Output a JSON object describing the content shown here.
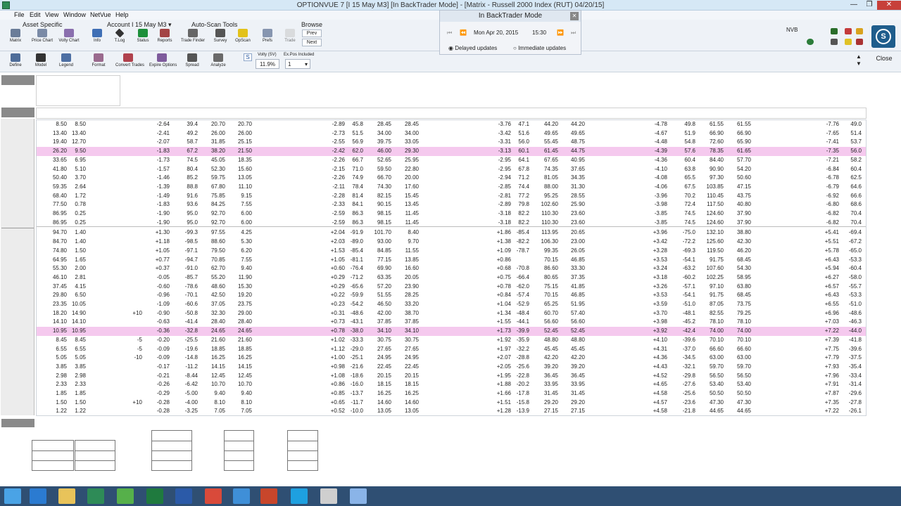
{
  "window": {
    "title": "OPTIONVUE 7   [I 15 May M3]   [In BackTrader Mode]  -  [Matrix - Russell 2000 Index (RUT)  04/20/15]",
    "minimize": "—",
    "restore": "❐",
    "close": "✕"
  },
  "menu": [
    "File",
    "Edit",
    "View",
    "Window",
    "NetVue",
    "Help"
  ],
  "toolbar": {
    "group_asset": "Asset Specific",
    "group_account": "Account I 15 May M3 ▾",
    "group_autoscan": "Auto-Scan Tools",
    "group_browse": "Browse",
    "buttons": [
      {
        "label": "Matrix",
        "icon": "matrix-icon"
      },
      {
        "label": "Price Chart",
        "icon": "price-chart-icon"
      },
      {
        "label": "Volty Chart",
        "icon": "volty-chart-icon"
      },
      {
        "label": "Info",
        "icon": "info-icon"
      },
      {
        "label": "T.Log",
        "icon": "tlog-icon"
      },
      {
        "label": "Status",
        "icon": "status-icon"
      },
      {
        "label": "Reports",
        "icon": "reports-icon"
      },
      {
        "label": "Trade Finder",
        "icon": "trade-finder-icon"
      },
      {
        "label": "Survey",
        "icon": "survey-icon"
      },
      {
        "label": "OpScan",
        "icon": "opscan-icon"
      },
      {
        "label": "Prefs",
        "icon": "prefs-icon"
      },
      {
        "label": "Trade",
        "icon": "trade-icon"
      }
    ],
    "browse_prev": "Prev",
    "browse_next": "Next"
  },
  "toolbar2": {
    "buttons": [
      {
        "label": "Define",
        "icon": "define-icon"
      },
      {
        "label": "Model",
        "icon": "model-icon"
      },
      {
        "label": "Legend",
        "icon": "legend-icon"
      },
      {
        "label": "Format",
        "icon": "format-icon"
      },
      {
        "label": "Convert Trades",
        "icon": "convert-trades-icon"
      },
      {
        "label": "Expire Options",
        "icon": "expire-options-icon"
      },
      {
        "label": "Spread",
        "icon": "spread-icon"
      },
      {
        "label": "Analyze",
        "icon": "analyze-icon"
      }
    ],
    "s_button": "S",
    "volty_label": "Volty (SV)",
    "volty_value": "11.9%",
    "expos_label": "Ex.Pos Included",
    "expos_value": "1"
  },
  "backtrader": {
    "title": "In BackTrader Mode",
    "date": "Mon Apr 20, 2015",
    "time": "15:30",
    "delayed": "Delayed updates",
    "immediate": "Immediate updates"
  },
  "right": {
    "nvb": "NVB",
    "close": "Close"
  },
  "rows": [
    {
      "c": [
        "8.50",
        "8.50",
        "",
        "-2.64",
        "39.4",
        "20.70",
        "20.70",
        "-2.89",
        "45.8",
        "28.45",
        "28.45",
        "-3.76",
        "47.1",
        "44.20",
        "44.20",
        "-4.78",
        "49.8",
        "61.55",
        "61.55",
        "-7.76",
        "49.0"
      ]
    },
    {
      "c": [
        "13.40",
        "13.40",
        "",
        "-2.41",
        "49.2",
        "26.00",
        "26.00",
        "-2.73",
        "51.5",
        "34.00",
        "34.00",
        "-3.42",
        "51.6",
        "49.65",
        "49.65",
        "-4.67",
        "51.9",
        "66.90",
        "66.90",
        "-7.65",
        "51.4"
      ]
    },
    {
      "c": [
        "19.40",
        "12.70",
        "",
        "-2.07",
        "58.7",
        "31.85",
        "25.15",
        "-2.55",
        "56.9",
        "39.75",
        "33.05",
        "-3.31",
        "56.0",
        "55.45",
        "48.75",
        "-4.48",
        "54.8",
        "72.60",
        "65.90",
        "-7.41",
        "53.7"
      ]
    },
    {
      "c": [
        "26.20",
        "9.50",
        "",
        "-1.83",
        "67.2",
        "38.20",
        "21.50",
        "-2.42",
        "62.0",
        "46.00",
        "29.30",
        "-3.13",
        "60.1",
        "61.45",
        "44.75",
        "-4.39",
        "57.6",
        "78.35",
        "61.65",
        "-7.35",
        "56.0"
      ],
      "hl": true
    },
    {
      "c": [
        "33.65",
        "6.95",
        "",
        "-1.73",
        "74.5",
        "45.05",
        "18.35",
        "-2.26",
        "66.7",
        "52.65",
        "25.95",
        "-2.95",
        "64.1",
        "67.65",
        "40.95",
        "-4.36",
        "60.4",
        "84.40",
        "57.70",
        "-7.21",
        "58.2"
      ]
    },
    {
      "c": [
        "41.80",
        "5.10",
        "",
        "-1.57",
        "80.4",
        "52.30",
        "15.60",
        "-2.15",
        "71.0",
        "59.50",
        "22.80",
        "-2.95",
        "67.8",
        "74.35",
        "37.65",
        "-4.10",
        "63.8",
        "90.90",
        "54.20",
        "-6.84",
        "60.4"
      ]
    },
    {
      "c": [
        "50.40",
        "3.70",
        "",
        "-1.46",
        "85.2",
        "59.75",
        "13.05",
        "-2.26",
        "74.9",
        "66.70",
        "20.00",
        "-2.94",
        "71.2",
        "81.05",
        "34.35",
        "-4.08",
        "65.5",
        "97.30",
        "50.60",
        "-6.78",
        "62.5"
      ]
    },
    {
      "c": [
        "59.35",
        "2.64",
        "",
        "-1.39",
        "88.8",
        "67.80",
        "11.10",
        "-2.11",
        "78.4",
        "74.30",
        "17.60",
        "-2.85",
        "74.4",
        "88.00",
        "31.30",
        "-4.06",
        "67.5",
        "103.85",
        "47.15",
        "-6.79",
        "64.6"
      ]
    },
    {
      "c": [
        "68.40",
        "1.72",
        "",
        "-1.49",
        "91.6",
        "75.85",
        "9.15",
        "-2.28",
        "81.4",
        "82.15",
        "15.45",
        "-2.81",
        "77.2",
        "95.25",
        "28.55",
        "-3.96",
        "70.2",
        "110.45",
        "43.75",
        "-6.92",
        "66.6"
      ]
    },
    {
      "c": [
        "77.50",
        "0.78",
        "",
        "-1.83",
        "93.6",
        "84.25",
        "7.55",
        "-2.33",
        "84.1",
        "90.15",
        "13.45",
        "-2.89",
        "79.8",
        "102.60",
        "25.90",
        "-3.98",
        "72.4",
        "117.50",
        "40.80",
        "-6.80",
        "68.6"
      ]
    },
    {
      "c": [
        "86.95",
        "0.25",
        "",
        "-1.90",
        "95.0",
        "92.70",
        "6.00",
        "-2.59",
        "86.3",
        "98.15",
        "11.45",
        "-3.18",
        "82.2",
        "110.30",
        "23.60",
        "-3.85",
        "74.5",
        "124.60",
        "37.90",
        "-6.82",
        "70.4"
      ]
    },
    {
      "c": [
        "86.95",
        "0.25",
        "",
        "-1.90",
        "95.0",
        "92.70",
        "6.00",
        "-2.59",
        "86.3",
        "98.15",
        "11.45",
        "-3.18",
        "82.2",
        "110.30",
        "23.60",
        "-3.85",
        "74.5",
        "124.60",
        "37.90",
        "-6.82",
        "70.4"
      ],
      "sep": true
    },
    {
      "c": [
        "94.70",
        "1.40",
        "",
        "+1.30",
        "-99.3",
        "97.55",
        "4.25",
        "+2.04",
        "-91.9",
        "101.70",
        "8.40",
        "+1.86",
        "-85.4",
        "113.95",
        "20.65",
        "+3.96",
        "-75.0",
        "132.10",
        "38.80",
        "+5.41",
        "-69.4"
      ]
    },
    {
      "c": [
        "84.70",
        "1.40",
        "",
        "+1.18",
        "-98.5",
        "88.60",
        "5.30",
        "+2.03",
        "-89.0",
        "93.00",
        "9.70",
        "+1.38",
        "-82.2",
        "106.30",
        "23.00",
        "+3.42",
        "-72.2",
        "125.60",
        "42.30",
        "+5.51",
        "-67.2"
      ]
    },
    {
      "c": [
        "74.80",
        "1.50",
        "",
        "+1.05",
        "-97.1",
        "79.50",
        "6.20",
        "+1.53",
        "-85.4",
        "84.85",
        "11.55",
        "+1.09",
        "-78.7",
        "99.35",
        "26.05",
        "+3.28",
        "-69.3",
        "119.50",
        "46.20",
        "+5.78",
        "-65.0"
      ]
    },
    {
      "c": [
        "64.95",
        "1.65",
        "",
        "+0.77",
        "-94.7",
        "70.85",
        "7.55",
        "+1.05",
        "-81.1",
        "77.15",
        "13.85",
        "+0.86",
        "",
        "70.15",
        "46.85",
        "+3.53",
        "-54.1",
        "91.75",
        "68.45",
        "+6.43",
        "-53.3"
      ]
    },
    {
      "c": [
        "55.30",
        "2.00",
        "",
        "+0.37",
        "-91.0",
        "62.70",
        "9.40",
        "+0.60",
        "-76.4",
        "69.90",
        "16.60",
        "+0.68",
        "-70.8",
        "86.60",
        "33.30",
        "+3.24",
        "-63.2",
        "107.60",
        "54.30",
        "+5.94",
        "-60.4"
      ]
    },
    {
      "c": [
        "46.10",
        "2.81",
        "",
        "-0.05",
        "-85.7",
        "55.20",
        "11.90",
        "+0.29",
        "-71.2",
        "63.35",
        "20.05",
        "+0.75",
        "-66.4",
        "80.65",
        "37.35",
        "+3.18",
        "-60.2",
        "102.25",
        "58.95",
        "+6.27",
        "-58.0"
      ]
    },
    {
      "c": [
        "37.45",
        "4.15",
        "",
        "-0.60",
        "-78.6",
        "48.60",
        "15.30",
        "+0.29",
        "-65.6",
        "57.20",
        "23.90",
        "+0.78",
        "-62.0",
        "75.15",
        "41.85",
        "+3.26",
        "-57.1",
        "97.10",
        "63.80",
        "+6.57",
        "-55.7"
      ]
    },
    {
      "c": [
        "29.80",
        "6.50",
        "",
        "-0.96",
        "-70.1",
        "42.50",
        "19.20",
        "+0.22",
        "-59.9",
        "51.55",
        "28.25",
        "+0.84",
        "-57.4",
        "70.15",
        "46.85",
        "+3.53",
        "-54.1",
        "91.75",
        "68.45",
        "+6.43",
        "-53.3"
      ]
    },
    {
      "c": [
        "23.35",
        "10.05",
        "",
        "-1.09",
        "-60.6",
        "37.05",
        "23.75",
        "+0.23",
        "-54.2",
        "46.50",
        "33.20",
        "+1.04",
        "-52.9",
        "65.25",
        "51.95",
        "+3.59",
        "-51.0",
        "87.05",
        "73.75",
        "+6.55",
        "-51.0"
      ]
    },
    {
      "c": [
        "18.20",
        "14.90",
        "+10",
        "-0.90",
        "-50.8",
        "32.30",
        "29.00",
        "+0.31",
        "-48.6",
        "42.00",
        "38.70",
        "+1.34",
        "-48.4",
        "60.70",
        "57.40",
        "+3.70",
        "-48.1",
        "82.55",
        "79.25",
        "+6.96",
        "-48.6"
      ]
    },
    {
      "c": [
        "14.10",
        "14.10",
        "",
        "-0.63",
        "-41.4",
        "28.40",
        "28.40",
        "+0.73",
        "-43.1",
        "37.85",
        "37.85",
        "+1.55",
        "-44.1",
        "56.60",
        "56.60",
        "+3.98",
        "-45.2",
        "78.10",
        "78.10",
        "+7.03",
        "-46.3"
      ]
    },
    {
      "c": [
        "10.95",
        "10.95",
        "",
        "-0.36",
        "-32.8",
        "24.65",
        "24.65",
        "+0.78",
        "-38.0",
        "34.10",
        "34.10",
        "+1.73",
        "-39.9",
        "52.45",
        "52.45",
        "+3.92",
        "-42.4",
        "74.00",
        "74.00",
        "+7.22",
        "-44.0"
      ],
      "hl": true
    },
    {
      "c": [
        "8.45",
        "8.45",
        "-5",
        "-0.20",
        "-25.5",
        "21.60",
        "21.60",
        "+1.02",
        "-33.3",
        "30.75",
        "30.75",
        "+1.92",
        "-35.9",
        "48.80",
        "48.80",
        "+4.10",
        "-39.6",
        "70.10",
        "70.10",
        "+7.39",
        "-41.8"
      ]
    },
    {
      "c": [
        "6.55",
        "6.55",
        "-5",
        "-0.09",
        "-19.6",
        "18.85",
        "18.85",
        "+1.12",
        "-29.0",
        "27.65",
        "27.65",
        "+1.97",
        "-32.2",
        "45.45",
        "45.45",
        "+4.31",
        "-37.0",
        "66.60",
        "66.60",
        "+7.75",
        "-39.6"
      ]
    },
    {
      "c": [
        "5.05",
        "5.05",
        "-10",
        "-0.09",
        "-14.8",
        "16.25",
        "16.25",
        "+1.00",
        "-25.1",
        "24.95",
        "24.95",
        "+2.07",
        "-28.8",
        "42.20",
        "42.20",
        "+4.36",
        "-34.5",
        "63.00",
        "63.00",
        "+7.79",
        "-37.5"
      ]
    },
    {
      "c": [
        "3.85",
        "3.85",
        "",
        "-0.17",
        "-11.2",
        "14.15",
        "14.15",
        "+0.98",
        "-21.6",
        "22.45",
        "22.45",
        "+2.05",
        "-25.6",
        "39.20",
        "39.20",
        "+4.43",
        "-32.1",
        "59.70",
        "59.70",
        "+7.93",
        "-35.4"
      ]
    },
    {
      "c": [
        "2.98",
        "2.98",
        "",
        "-0.21",
        "-8.44",
        "12.45",
        "12.45",
        "+1.08",
        "-18.6",
        "20.15",
        "20.15",
        "+1.95",
        "-22.8",
        "36.45",
        "36.45",
        "+4.52",
        "-29.8",
        "56.50",
        "56.50",
        "+7.96",
        "-33.4"
      ]
    },
    {
      "c": [
        "2.33",
        "2.33",
        "",
        "-0.26",
        "-6.42",
        "10.70",
        "10.70",
        "+0.86",
        "-16.0",
        "18.15",
        "18.15",
        "+1.88",
        "-20.2",
        "33.95",
        "33.95",
        "+4.65",
        "-27.6",
        "53.40",
        "53.40",
        "+7.91",
        "-31.4"
      ]
    },
    {
      "c": [
        "1.85",
        "1.85",
        "",
        "-0.29",
        "-5.00",
        "9.40",
        "9.40",
        "+0.85",
        "-13.7",
        "16.25",
        "16.25",
        "+1.66",
        "-17.8",
        "31.45",
        "31.45",
        "+4.58",
        "-25.6",
        "50.50",
        "50.50",
        "+7.87",
        "-29.6"
      ]
    },
    {
      "c": [
        "1.50",
        "1.50",
        "+10",
        "-0.28",
        "-4.00",
        "8.10",
        "8.10",
        "+0.65",
        "-11.7",
        "14.60",
        "14.60",
        "+1.51",
        "-15.8",
        "29.20",
        "29.20",
        "+4.57",
        "-23.6",
        "47.30",
        "47.30",
        "+7.35",
        "-27.8"
      ]
    },
    {
      "c": [
        "1.22",
        "1.22",
        "",
        "-0.28",
        "-3.25",
        "7.05",
        "7.05",
        "+0.52",
        "-10.0",
        "13.05",
        "13.05",
        "+1.28",
        "-13.9",
        "27.15",
        "27.15",
        "+4.58",
        "-21.8",
        "44.65",
        "44.65",
        "+7.22",
        "-26.1"
      ]
    }
  ],
  "taskbar": [
    {
      "icon": "windows-start-icon",
      "color": "#4aa3e6"
    },
    {
      "icon": "internet-explorer-icon",
      "color": "#2b7bd1"
    },
    {
      "icon": "file-explorer-icon",
      "color": "#e8c35a"
    },
    {
      "icon": "optionvue-icon",
      "color": "#2e8b57"
    },
    {
      "icon": "green-app-icon",
      "color": "#56b04a"
    },
    {
      "icon": "excel-icon",
      "color": "#1f7a3e"
    },
    {
      "icon": "word-icon",
      "color": "#2b5aa8"
    },
    {
      "icon": "chrome-icon",
      "color": "#d94a3a"
    },
    {
      "icon": "outlook-icon",
      "color": "#3f8fd8"
    },
    {
      "icon": "powerpoint-icon",
      "color": "#c8462b"
    },
    {
      "icon": "skype-icon",
      "color": "#1ea0e0"
    },
    {
      "icon": "camera-icon",
      "color": "#cfcfcf"
    },
    {
      "icon": "snowflake-icon",
      "color": "#8ab4e8"
    }
  ]
}
